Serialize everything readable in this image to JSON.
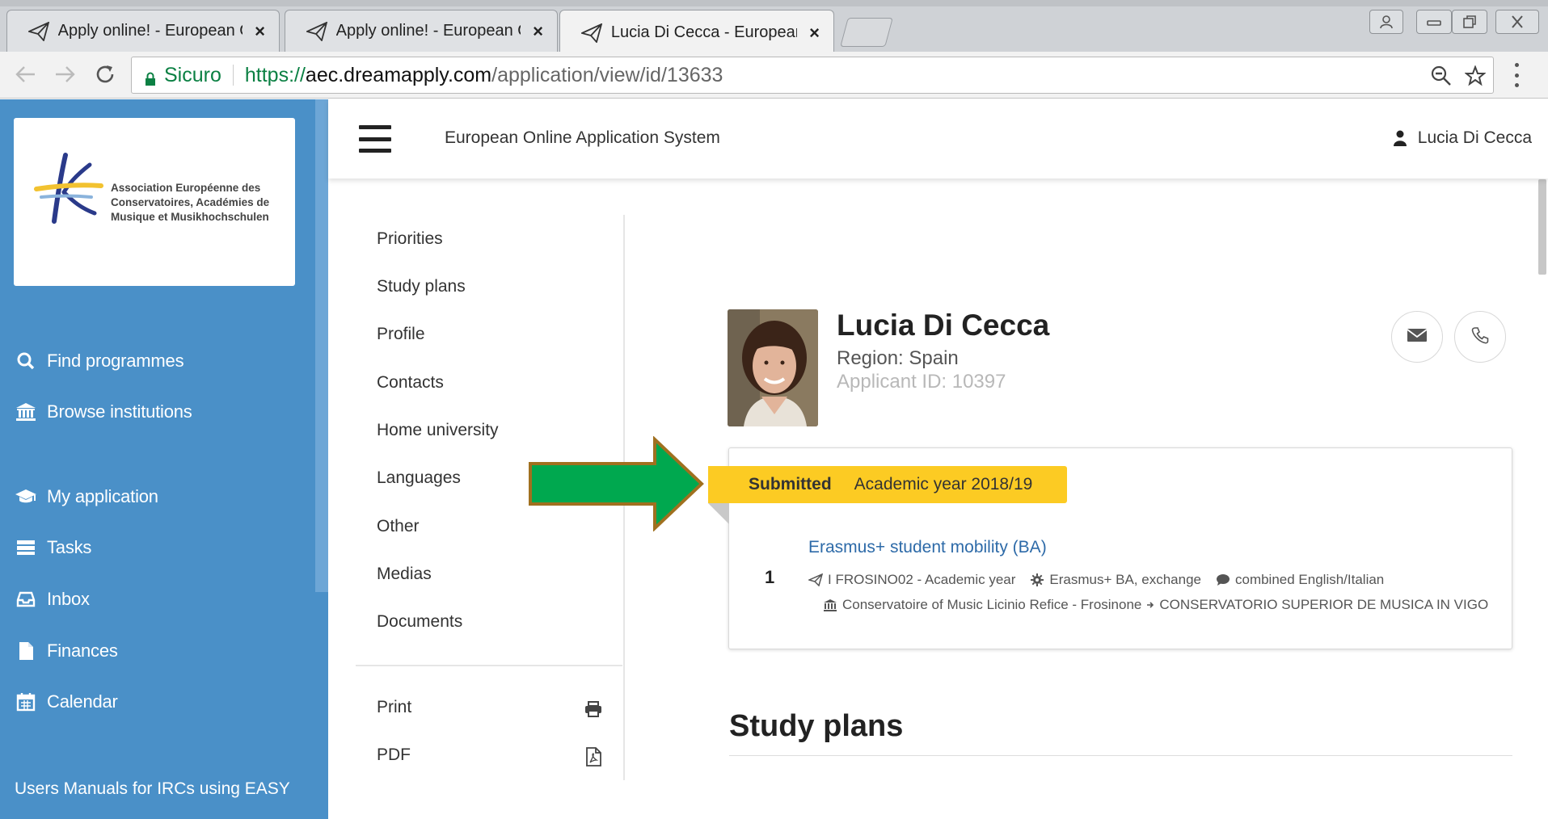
{
  "browser": {
    "tabs": [
      {
        "title": "Apply online! - European On",
        "active": false
      },
      {
        "title": "Apply online! - European On",
        "active": false
      },
      {
        "title": "Lucia Di Cecca - European O",
        "active": true
      }
    ],
    "close_glyph": "×",
    "address": {
      "secure_label": "Sicuro",
      "scheme": "https://",
      "host": "aec.dreamapply.com",
      "path": "/application/view/id/13633"
    }
  },
  "sidebar": {
    "logo_text": [
      "Association Européenne des",
      "Conservatoires, Académies de",
      "Musique et Musikhochschulen"
    ],
    "items": [
      {
        "label": "Find programmes",
        "icon": "search-icon"
      },
      {
        "label": "Browse institutions",
        "icon": "institution-icon"
      },
      {
        "label": "My application",
        "icon": "graduation-cap-icon"
      },
      {
        "label": "Tasks",
        "icon": "tasks-icon"
      },
      {
        "label": "Inbox",
        "icon": "inbox-icon"
      },
      {
        "label": "Finances",
        "icon": "file-icon"
      },
      {
        "label": "Calendar",
        "icon": "calendar-icon"
      }
    ],
    "footer": "Users Manuals for IRCs using EASY"
  },
  "header": {
    "title": "European Online Application System",
    "user": "Lucia Di Cecca"
  },
  "subnav": {
    "items": [
      "Priorities",
      "Study plans",
      "Profile",
      "Contacts",
      "Home university",
      "Languages",
      "Other",
      "Medias",
      "Documents"
    ],
    "actions": [
      {
        "label": "Print",
        "icon": "print-icon"
      },
      {
        "label": "PDF",
        "icon": "pdf-icon"
      }
    ]
  },
  "profile": {
    "name": "Lucia Di Cecca",
    "region": "Region: Spain",
    "applicant_id": "Applicant ID: 10397"
  },
  "application": {
    "status": "Submitted",
    "year": "Academic year 2018/19",
    "number": "1",
    "programme": "Erasmus+ student mobility (BA)",
    "code": "I FROSINO02 - Academic year",
    "type": "Erasmus+ BA, exchange",
    "language": "combined English/Italian",
    "institution_home": "Conservatoire of Music Licinio Refice - Frosinone",
    "institution_host": "CONSERVATORIO SUPERIOR DE MUSICA IN VIGO"
  },
  "sections": {
    "study_plans_title": "Study plans"
  },
  "colors": {
    "sidebar": "#4a90c8",
    "ribbon": "#fccb23",
    "arrow": "#00a84f",
    "arrow_border": "#a0701f",
    "link": "#2d6aa8"
  }
}
